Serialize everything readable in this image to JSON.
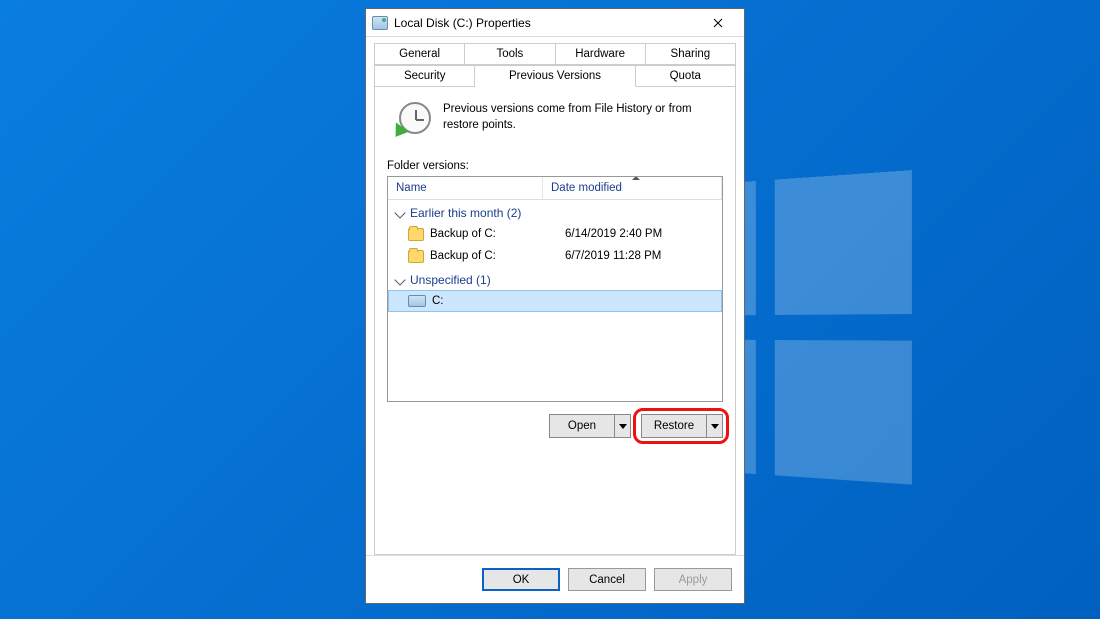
{
  "window": {
    "title": "Local Disk (C:) Properties"
  },
  "tabs": {
    "row1": [
      "General",
      "Tools",
      "Hardware",
      "Sharing"
    ],
    "row2": [
      "Security",
      "Previous Versions",
      "Quota"
    ],
    "active": "Previous Versions"
  },
  "info_text": "Previous versions come from File History or from restore points.",
  "folder_versions_label": "Folder versions:",
  "columns": {
    "name": "Name",
    "date": "Date modified"
  },
  "groups": [
    {
      "title": "Earlier this month (2)",
      "items": [
        {
          "icon": "folder",
          "name": "Backup of C:",
          "date": "6/14/2019 2:40 PM",
          "selected": false
        },
        {
          "icon": "folder",
          "name": "Backup of C:",
          "date": "6/7/2019 11:28 PM",
          "selected": false
        }
      ]
    },
    {
      "title": "Unspecified (1)",
      "items": [
        {
          "icon": "drive",
          "name": "C:",
          "date": "",
          "selected": true
        }
      ]
    }
  ],
  "actions": {
    "open": "Open",
    "restore": "Restore"
  },
  "buttons": {
    "ok": "OK",
    "cancel": "Cancel",
    "apply": "Apply"
  }
}
